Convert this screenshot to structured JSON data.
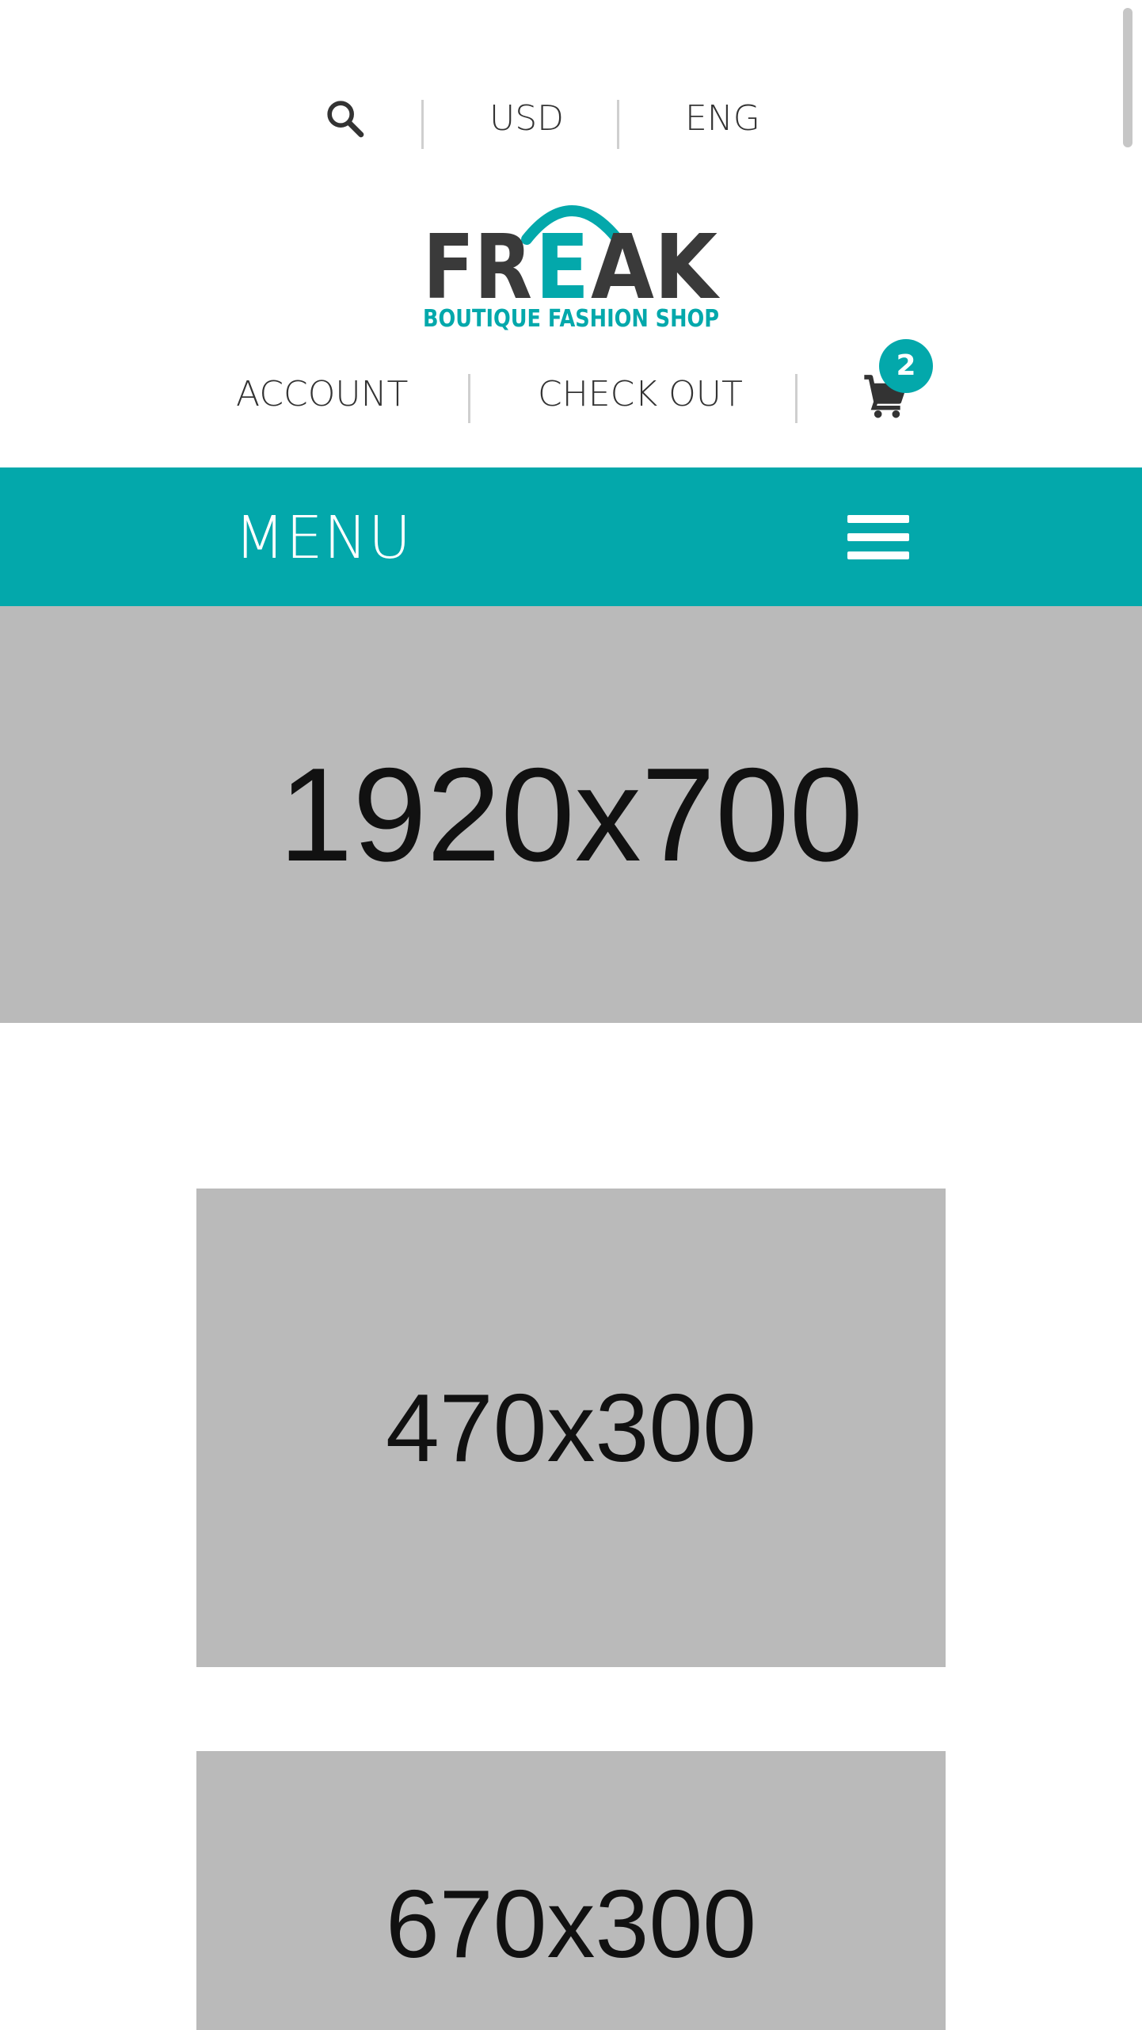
{
  "topbar": {
    "search_icon": "search-icon",
    "currency": "USD",
    "language": "ENG"
  },
  "logo": {
    "brand": "FREAK",
    "tagline": "BOUTIQUE FASHION SHOP",
    "colors": {
      "dark": "#3a3a3a",
      "accent": "#03a8ab"
    }
  },
  "account_nav": {
    "account": "ACCOUNT",
    "checkout": "CHECK OUT",
    "cart_icon": "cart-icon",
    "cart_count": "2"
  },
  "menu": {
    "label": "MENU",
    "icon": "hamburger-icon",
    "background": "#03a8ab"
  },
  "banners": {
    "hero": "1920x700",
    "promo_1": "470x300",
    "promo_2": "670x300"
  }
}
